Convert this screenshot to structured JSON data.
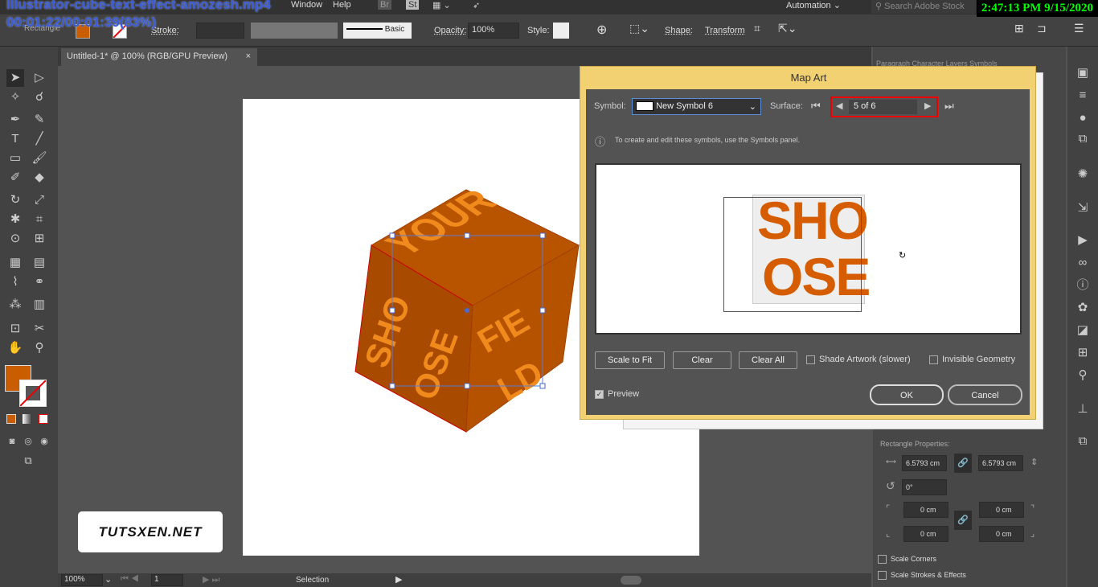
{
  "overlay": {
    "filename": "Illustrator-cube-text-effect-amozesh.mp4",
    "progress": "00:01:22/00:01:39(83%)",
    "clock": "2:47:13 PM 9/15/2020"
  },
  "menu": {
    "window": "Window",
    "help": "Help",
    "br": "Br",
    "st": "St",
    "workspace": "Automation",
    "search_placeholder": "Search Adobe Stock"
  },
  "control": {
    "object": "Rectangle",
    "fill_color": "#c95d00",
    "stroke_label": "Stroke:",
    "brush": "Basic",
    "opacity_label": "Opacity:",
    "opacity": "100%",
    "style_label": "Style:",
    "shape": "Shape:",
    "transform": "Transform"
  },
  "document": {
    "tab": "Untitled-1* @ 100% (RGB/GPU Preview)",
    "close": "×"
  },
  "cube": {
    "top": "YOUR",
    "left_a": "SHO",
    "left_b": "OSE",
    "right_a": "FIE",
    "right_b": "LD",
    "color": "#c25a00"
  },
  "watermark": "TUTSXEN.NET",
  "status": {
    "zoom": "100%",
    "page": "1",
    "tool": "Selection"
  },
  "panel_tabs": [
    "Paragraph",
    "Character",
    "Layers",
    "Symbols"
  ],
  "dialog": {
    "title": "Map Art",
    "symbol_label": "Symbol:",
    "symbol": "New Symbol 6",
    "surface_label": "Surface:",
    "surface": "5 of 6",
    "info": "To create and edit these symbols, use the Symbols panel.",
    "preview_text_1": "SHO",
    "preview_text_2": "OSE",
    "scale_to_fit": "Scale to Fit",
    "clear": "Clear",
    "clear_all": "Clear All",
    "shade": "Shade Artwork (slower)",
    "invisible": "Invisible Geometry",
    "preview": "Preview",
    "preview_checked": true,
    "ok": "OK",
    "cancel": "Cancel"
  },
  "properties": {
    "title": "Rectangle Properties:",
    "width": "6.5793 cm",
    "height": "6.5793 cm",
    "rotation": "0°",
    "corner_tl": "0 cm",
    "corner_tr": "0 cm",
    "corner_bl": "0 cm",
    "corner_br": "0 cm",
    "scale_corners": "Scale Corners",
    "scale_strokes": "Scale Strokes & Effects"
  }
}
